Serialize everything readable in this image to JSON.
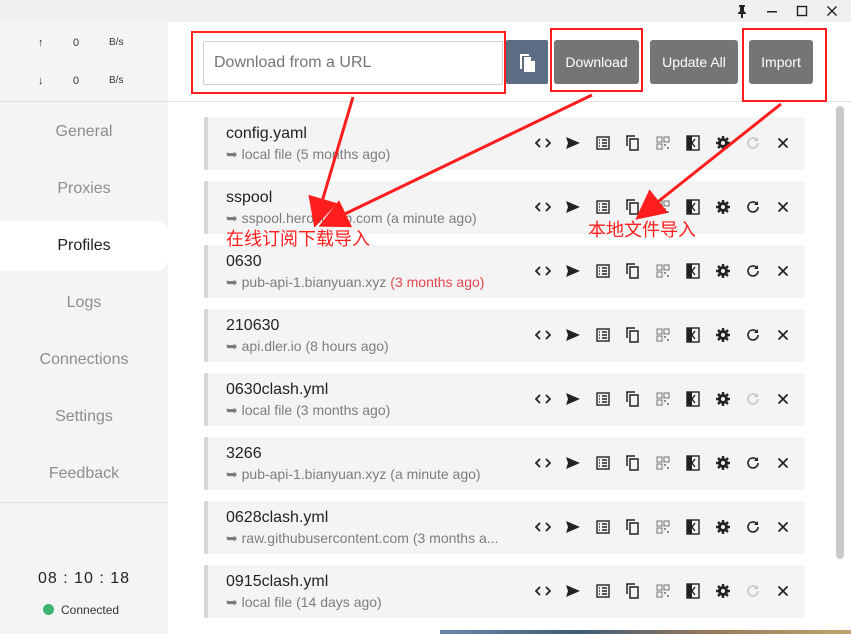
{
  "traffic": {
    "up_arrow": "↑",
    "up_value": "0",
    "up_unit": "B/s",
    "down_arrow": "↓",
    "down_value": "0",
    "down_unit": "B/s"
  },
  "nav": [
    {
      "label": "General"
    },
    {
      "label": "Proxies"
    },
    {
      "label": "Profiles"
    },
    {
      "label": "Logs"
    },
    {
      "label": "Connections"
    },
    {
      "label": "Settings"
    },
    {
      "label": "Feedback"
    }
  ],
  "clock": "08 : 10 : 18",
  "status": "Connected",
  "header": {
    "url_placeholder": "Download from a URL",
    "download_label": "Download",
    "update_all_label": "Update All",
    "import_label": "Import"
  },
  "profiles": [
    {
      "name": "config.yaml",
      "source": "local file (5 months ago)",
      "source_text": "local file",
      "time": "(5 months ago)",
      "time_highlight": false,
      "local": true
    },
    {
      "name": "sspool",
      "source_text": "sspool.herokuapp.com",
      "time": "(a minute ago)",
      "time_highlight": false,
      "local": false
    },
    {
      "name": "0630",
      "source_text": "pub-api-1.bianyuan.xyz",
      "time": "(3 months ago)",
      "time_highlight": true,
      "local": false
    },
    {
      "name": "210630",
      "source_text": "api.dler.io",
      "time": "(8 hours ago)",
      "time_highlight": false,
      "local": false
    },
    {
      "name": "0630clash.yml",
      "source_text": "local file",
      "time": "(3 months ago)",
      "time_highlight": false,
      "local": true
    },
    {
      "name": "3266",
      "source_text": "pub-api-1.bianyuan.xyz",
      "time": "(a minute ago)",
      "time_highlight": false,
      "local": false
    },
    {
      "name": "0628clash.yml",
      "source_text": "raw.githubusercontent.com",
      "time": "(3 months a...",
      "time_highlight": false,
      "local": false
    },
    {
      "name": "0915clash.yml",
      "source_text": "local file",
      "time": "(14 days ago)",
      "time_highlight": false,
      "local": true
    }
  ],
  "annotations": {
    "online_import": "在线订阅下载导入",
    "local_import": "本地文件导入"
  },
  "colors": {
    "accent_red": "#ff1d1d",
    "button_gray": "#757575",
    "paste_button": "#5b6d83",
    "connected_dot": "#3cb371",
    "highlight_time": "#e5484d"
  }
}
